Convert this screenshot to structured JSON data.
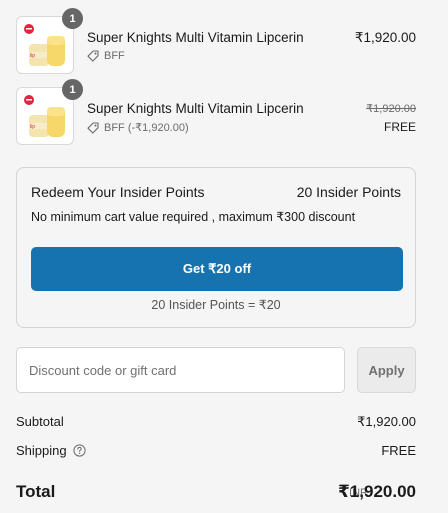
{
  "line_items": [
    {
      "quantity": "1",
      "name": "Super Knights Multi Vitamin Lipcerin",
      "discount_code": "BFF",
      "price": "₹1,920.00"
    },
    {
      "quantity": "1",
      "name": "Super Knights Multi Vitamin Lipcerin",
      "discount_code": "BFF (-₹1,920.00)",
      "original_price": "₹1,920.00",
      "price": "FREE"
    }
  ],
  "redeem": {
    "title": "Redeem Your Insider Points",
    "points": "20 Insider Points",
    "subtitle": "No minimum cart value required , maximum ₹300 discount",
    "button_label": "Get ₹20 off",
    "conversion_note": "20 Insider Points = ₹20"
  },
  "discount": {
    "placeholder": "Discount code or gift card",
    "value": "",
    "apply_label": "Apply"
  },
  "summary": {
    "subtotal_label": "Subtotal",
    "subtotal_value": "₹1,920.00",
    "shipping_label": "Shipping",
    "shipping_value": "FREE",
    "total_label": "Total",
    "total_currency": "INR",
    "total_value": "₹1,920.00"
  },
  "colors": {
    "accent": "#1773b0",
    "background": "#f5f5f5",
    "badge": "#666666",
    "brand_red": "#e0263a"
  },
  "icons": {
    "discount_tag": "tag-icon",
    "shipping_help": "question-circle-icon"
  }
}
